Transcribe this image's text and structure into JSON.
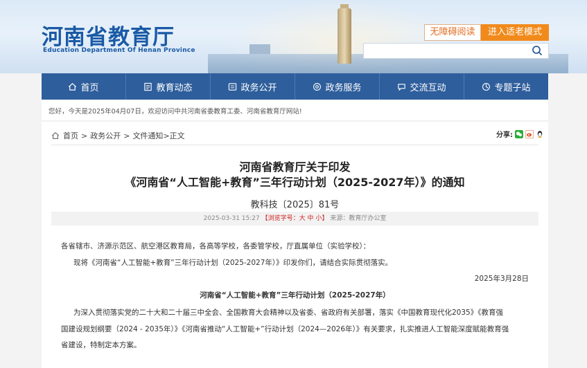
{
  "header": {
    "site_title": "河南省教育厅",
    "site_subtitle": "Education Department Of Henan Province",
    "accessibility_label": "无障碍阅读",
    "elder_mode_label": "进入适老模式",
    "search_placeholder": ""
  },
  "nav": {
    "items": [
      {
        "label": "首页",
        "icon": "home-icon"
      },
      {
        "label": "教育动态",
        "icon": "news-icon"
      },
      {
        "label": "政务公开",
        "icon": "document-icon"
      },
      {
        "label": "政务服务",
        "icon": "service-icon"
      },
      {
        "label": "交流互动",
        "icon": "chat-icon"
      },
      {
        "label": "专题子站",
        "icon": "grid-icon"
      }
    ]
  },
  "welcome": {
    "text": "您好，今天是2025年04月07日，欢迎访问中共河南省委教育工委、河南省教育厅网站!"
  },
  "breadcrumb": {
    "items": [
      "首页",
      "政务公开",
      "文件通知",
      "正文"
    ],
    "sep": ">"
  },
  "share": {
    "label": "分享:",
    "icons": [
      "wechat-icon",
      "weibo-icon",
      "qq-icon"
    ]
  },
  "article": {
    "title_line1": "河南省教育厅关于印发",
    "title_line2": "《河南省“人工智能+教育”三年行动计划（2025-2027年）》的通知",
    "doc_number": "教科技〔2025〕81号",
    "meta_date": "2025-03-31 15:27",
    "meta_size_prefix": "【浏览字号：",
    "size_large": "大",
    "size_medium": "中",
    "size_small": "小",
    "meta_size_suffix": "】",
    "meta_source": "来源：教育厅办公室",
    "addressees": "各省辖市、济源示范区、航空港区教育局，各高等学校，各委管学校，厅直属单位（实验学校）：",
    "notice": "现将《河南省“人工智能+教育”三年行动计划（2025-2027年）》印发你们，请结合实际贯彻落实。",
    "sign_date": "2025年3月28日",
    "plan_title": "河南省“人工智能+教育”三年行动计划（2025-2027年）",
    "para_line1": "为深入贯彻落实党的二十大和二十届三中全会、全国教育大会精神以及省委、省政府有关部署，落实《中国教育现代化2035》《教育强",
    "para_line2": "国建设规划纲要（2024 - 2035年）》《河南省推动“人工智能+”行动计划（2024—2026年）》有关要求，扎实推进人工智能深度赋能教育强",
    "para_line3": "省建设，特制定本方案。"
  },
  "colors": {
    "nav_bg": "#2e5e9c",
    "brand_blue": "#1a5aa6",
    "elder_button": "#f18a1b",
    "size_red": "#d02020"
  }
}
